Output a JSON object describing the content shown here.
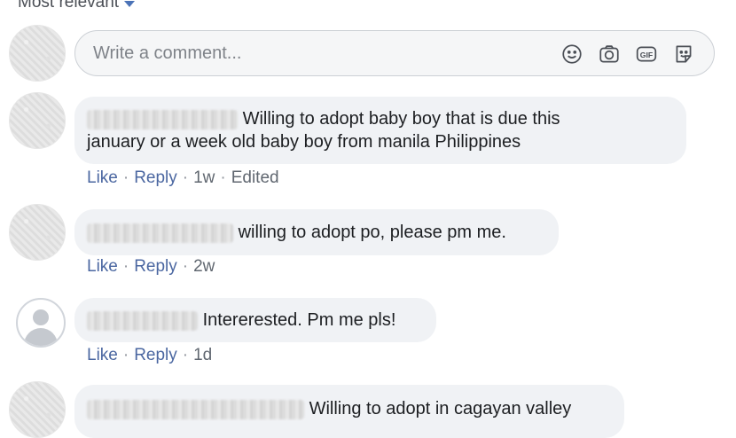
{
  "sort": {
    "label": "Most relevant"
  },
  "composer": {
    "placeholder": "Write a comment...",
    "icons": [
      "emoji-icon",
      "camera-icon",
      "gif-icon",
      "sticker-icon"
    ],
    "gif_label": "GIF"
  },
  "comments": [
    {
      "text_line1": "Willing to adopt baby boy that is due this",
      "text_line2": "january or a week old baby boy from manila Philippines",
      "like": "Like",
      "reply": "Reply",
      "time": "1w",
      "edited": "Edited"
    },
    {
      "text_line1": "willing to adopt po, please pm me.",
      "like": "Like",
      "reply": "Reply",
      "time": "2w"
    },
    {
      "text_line1": "Intererested. Pm me pls!",
      "like": "Like",
      "reply": "Reply",
      "time": "1d"
    },
    {
      "text_line1": "Willing to adopt in cagayan valley"
    }
  ],
  "colors": {
    "link": "#4b67a1",
    "bubble": "#f0f2f5",
    "accent": "#4b73b7"
  }
}
